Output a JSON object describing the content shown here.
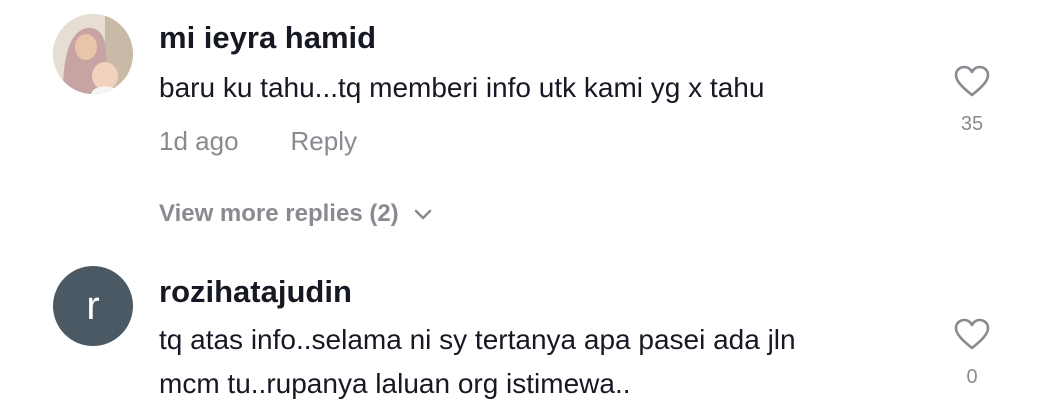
{
  "comments": [
    {
      "username": "mi ieyra hamid",
      "text_lines": [
        "baru ku tahu...tq memberi info utk kami yg x tahu"
      ],
      "time": "1d ago",
      "reply_label": "Reply",
      "likes": "35",
      "view_more": "View more replies (2)",
      "avatar": "photo"
    },
    {
      "username": "rozihatajudin",
      "text_lines": [
        "tq atas info..selama ni sy tertanya apa pasei ada jln",
        "mcm tu..rupanya laluan org istimewa.."
      ],
      "likes": "0",
      "avatar_letter": "r",
      "avatar_color": "#4a5963"
    }
  ],
  "icons": {
    "like": "heart-outline-icon",
    "expand": "chevron-down-icon"
  }
}
